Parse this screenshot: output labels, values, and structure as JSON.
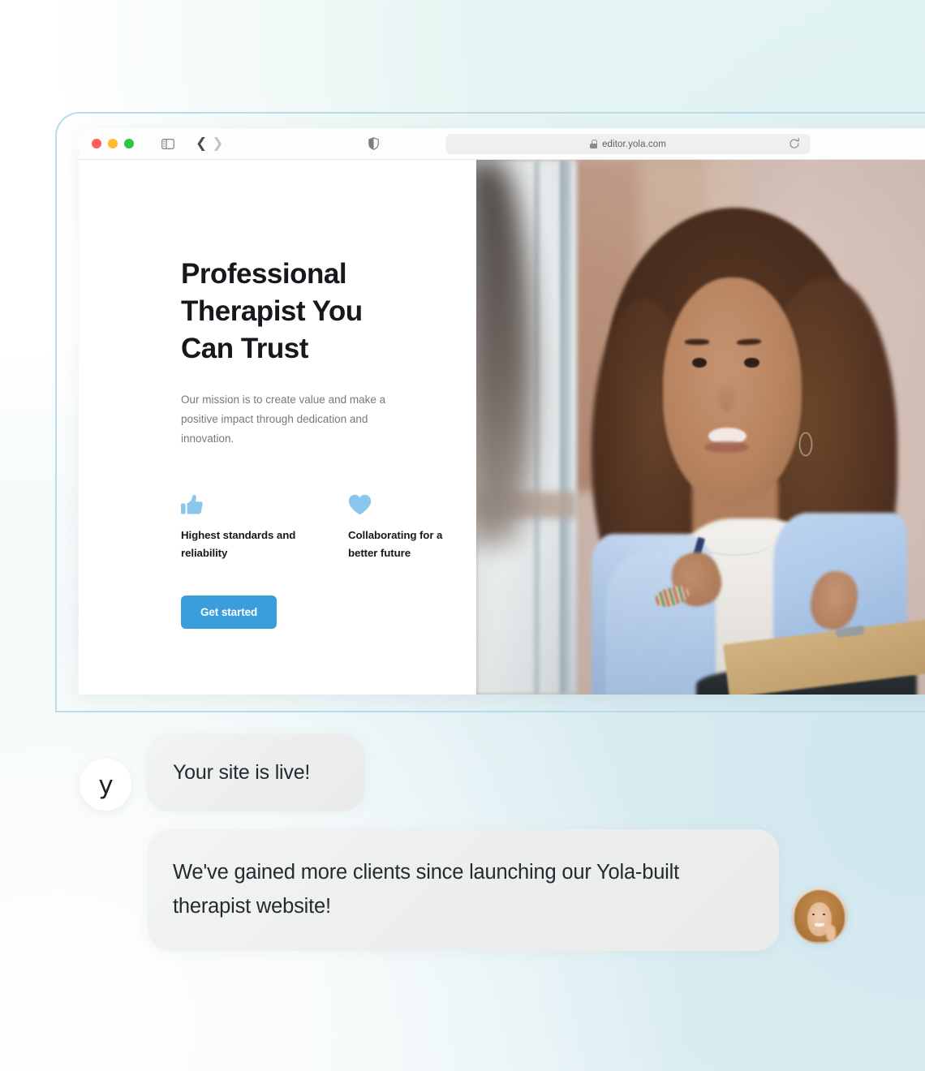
{
  "browser": {
    "traffic_lights": [
      "close",
      "minimize",
      "zoom"
    ],
    "sidebar_icon": "sidebar-icon",
    "back_icon": "chevron-left-icon",
    "forward_icon": "chevron-right-icon",
    "shield_icon": "shield-icon",
    "lock_icon": "lock-icon",
    "url": "editor.yola.com",
    "reload_icon": "reload-icon",
    "colors": {
      "red": "#ff5f57",
      "yellow": "#febc2e",
      "green": "#28c840",
      "urlbar_bg": "#efefef"
    }
  },
  "site": {
    "hero": {
      "title": "Professional Therapist You Can Trust",
      "subtitle": "Our mission is to create value and make a positive impact through dedication and innovation.",
      "cta_label": "Get started",
      "cta_color": "#3a9ddc",
      "icon_color": "#8cc6ed"
    },
    "features": [
      {
        "icon": "thumbs-up-icon",
        "label": "Highest standards and reliability"
      },
      {
        "icon": "heart-icon",
        "label": "Collaborating for a better future"
      }
    ],
    "photo_alt": "Therapist with curly hair in light blue cardigan holding clipboard and pen"
  },
  "chat": {
    "brand_mark": "y",
    "messages": [
      {
        "sender": "yola",
        "text": "Your site is live!"
      },
      {
        "sender": "client",
        "text": "We've gained more clients since launching our Yola-built therapist website!"
      }
    ],
    "client_avatar_alt": "Smiling woman with light brown hair"
  },
  "background": {
    "accent_border": "#b9dcec",
    "tint_top_right": "#e2f4f2",
    "tint_right": "#cfe6ee"
  }
}
